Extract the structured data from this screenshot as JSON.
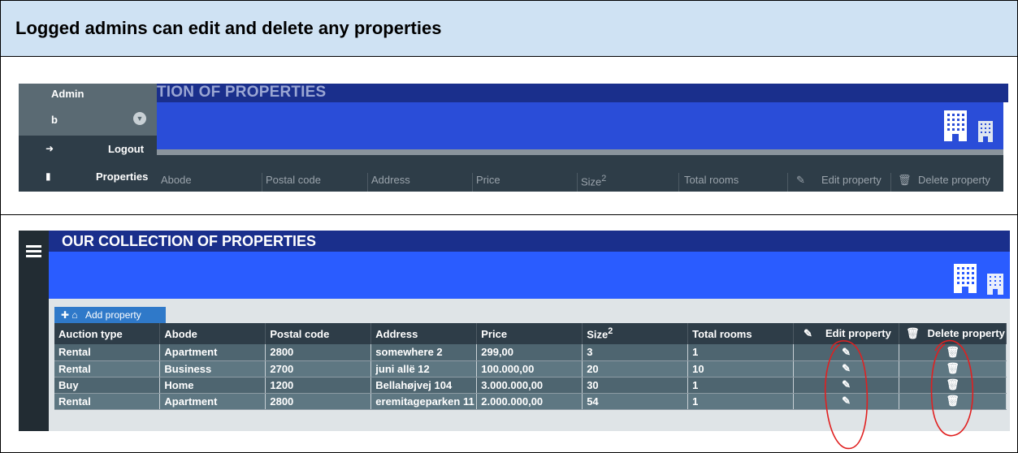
{
  "header": {
    "title": "Logged admins can edit and delete any properties"
  },
  "panel1": {
    "title_fragment": "TION OF PROPERTIES",
    "menu": {
      "user_role": "Admin",
      "user_name": "b",
      "items": [
        {
          "label": "Logout",
          "icon": "sign-out-icon"
        },
        {
          "label": "Properties",
          "icon": "building-icon"
        }
      ]
    },
    "columns": [
      "Abode",
      "Postal code",
      "Address",
      "Price",
      "Size",
      "Total rooms",
      "Edit property",
      "Delete property"
    ],
    "size_sup": "2"
  },
  "panel2": {
    "title": "OUR COLLECTION OF PROPERTIES",
    "add_button": "Add property",
    "columns": {
      "auction_type": "Auction type",
      "abode": "Abode",
      "postal_code": "Postal code",
      "address": "Address",
      "price": "Price",
      "size": "Size",
      "size_sup": "2",
      "total_rooms": "Total rooms",
      "edit": "Edit property",
      "delete": "Delete property"
    },
    "rows": [
      {
        "auction_type": "Rental",
        "abode": "Apartment",
        "postal_code": "2800",
        "address": "somewhere 2",
        "price": "299,00",
        "size": "3",
        "total_rooms": "1"
      },
      {
        "auction_type": "Rental",
        "abode": "Business",
        "postal_code": "2700",
        "address": "juni allë 12",
        "price": "100.000,00",
        "size": "20",
        "total_rooms": "10"
      },
      {
        "auction_type": "Buy",
        "abode": "Home",
        "postal_code": "1200",
        "address": "Bellahøjvej 104",
        "price": "3.000.000,00",
        "size": "30",
        "total_rooms": "1"
      },
      {
        "auction_type": "Rental",
        "abode": "Apartment",
        "postal_code": "2800",
        "address": "eremitageparken 11",
        "price": "2.000.000,00",
        "size": "54",
        "total_rooms": "1"
      }
    ]
  },
  "colors": {
    "header_bg": "#cfe2f3",
    "title_bar": "#1a2f8c",
    "banner": "#2a5cff",
    "table_header": "#2e3d48",
    "row_odd": "#4e6570",
    "row_even": "#5e7782",
    "accent_button": "#2f79c9",
    "annotation": "#e02020"
  }
}
